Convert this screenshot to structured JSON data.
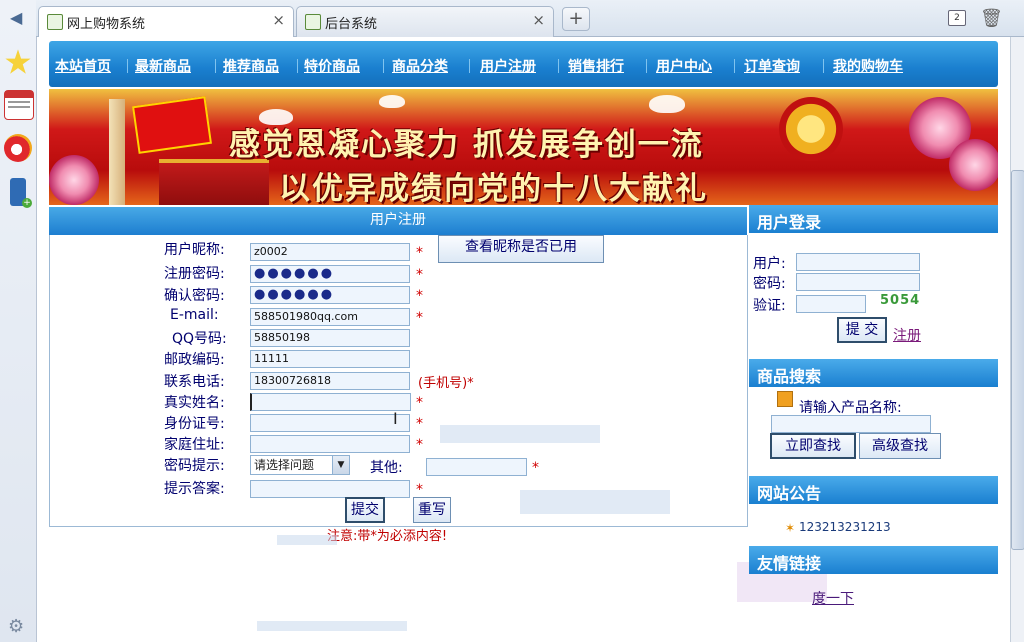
{
  "browser": {
    "tabs": [
      {
        "title": "网上购物系统",
        "active": true
      },
      {
        "title": "后台系统",
        "active": false
      }
    ],
    "new_tab": "+",
    "tab_count": "2"
  },
  "nav": {
    "items": [
      "本站首页",
      "最新商品",
      "推荐商品",
      "特价商品",
      "商品分类",
      "用户注册",
      "销售排行",
      "用户中心",
      "订单查询",
      "我的购物车"
    ]
  },
  "banner": {
    "line1": "感觉恩凝心聚力   抓发展争创一流",
    "line2": "以优异成绩向党的十八大献礼"
  },
  "register": {
    "title": "用户注册",
    "labels": {
      "nickname": "用户昵称:",
      "password": "注册密码:",
      "confirm": "确认密码:",
      "email": "E-mail:",
      "qq": "QQ号码:",
      "zip": "邮政编码:",
      "phone": "联系电话:",
      "realname": "真实姓名:",
      "idcard": "身份证号:",
      "address": "家庭住址:",
      "hint": "密码提示:",
      "other": "其他:",
      "answer": "提示答案:"
    },
    "values": {
      "nickname": "z0002",
      "password": "●●●●●●",
      "confirm": "●●●●●●",
      "email": "588501980qq.com",
      "qq": "58850198",
      "zip": "11111",
      "phone": "18300726818",
      "realname": "",
      "idcard": "",
      "address": "",
      "hint_select": "请选择问题",
      "other": "",
      "answer": ""
    },
    "required_mark": "*",
    "phone_note": "(手机号)*",
    "check_button": "查看昵称是否已用",
    "submit_button": "提交",
    "reset_button": "重写",
    "notice": "注意:带*为必添内容!"
  },
  "login": {
    "title": "用户登录",
    "user_label": "用户:",
    "password_label": "密码:",
    "captcha_label": "验证:",
    "captcha_code": "5054",
    "submit_button": "提 交",
    "register_link": "注册"
  },
  "search": {
    "title": "商品搜索",
    "prompt": "请输入产品名称:",
    "search_button": "立即查找",
    "advanced_button": "高级查找"
  },
  "notice_board": {
    "title": "网站公告",
    "items": [
      "123213231213"
    ]
  },
  "links": {
    "title": "友情链接",
    "items": [
      "度一下"
    ]
  },
  "colors": {
    "nav_blue": "#1a7fcf",
    "label_navy": "#00006e",
    "required_red": "#d00000"
  }
}
